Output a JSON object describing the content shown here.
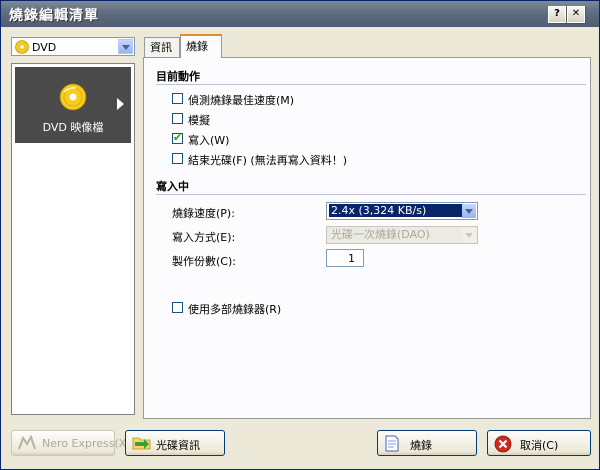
{
  "window": {
    "title": "燒錄編輯清單",
    "help_label": "?",
    "close_label": "✕"
  },
  "left": {
    "disc_type": "DVD",
    "tile_label": "DVD 映像檔"
  },
  "tabs": [
    {
      "label": "資訊"
    },
    {
      "label": "燒錄"
    }
  ],
  "current_action": {
    "title": "目前動作",
    "options": [
      {
        "label": "偵測燒錄最佳速度(M)",
        "checked": false
      },
      {
        "label": "模擬",
        "checked": false
      },
      {
        "label": "寫入(W)",
        "checked": true
      },
      {
        "label": "結束光碟(F) (無法再寫入資料！)",
        "checked": false
      }
    ]
  },
  "writing": {
    "title": "寫入中",
    "speed_label": "燒錄速度(P):",
    "speed_value": "2.4x (3,324 KB/s)",
    "method_label": "寫入方式(E):",
    "method_value": "光碟一次燒錄(DAO)",
    "copies_label": "製作份數(C):",
    "copies_value": "1",
    "multi_label": "使用多部燒錄器(R)",
    "multi_checked": false
  },
  "buttons": {
    "nero_express": "Nero Express(X)",
    "disc_info": "光碟資訊",
    "burn": "燒錄",
    "cancel": "取消(C)"
  },
  "colors": {
    "title_bar": "#5f6e80",
    "accent": "#e68b2c",
    "selection": "#0a246a"
  }
}
